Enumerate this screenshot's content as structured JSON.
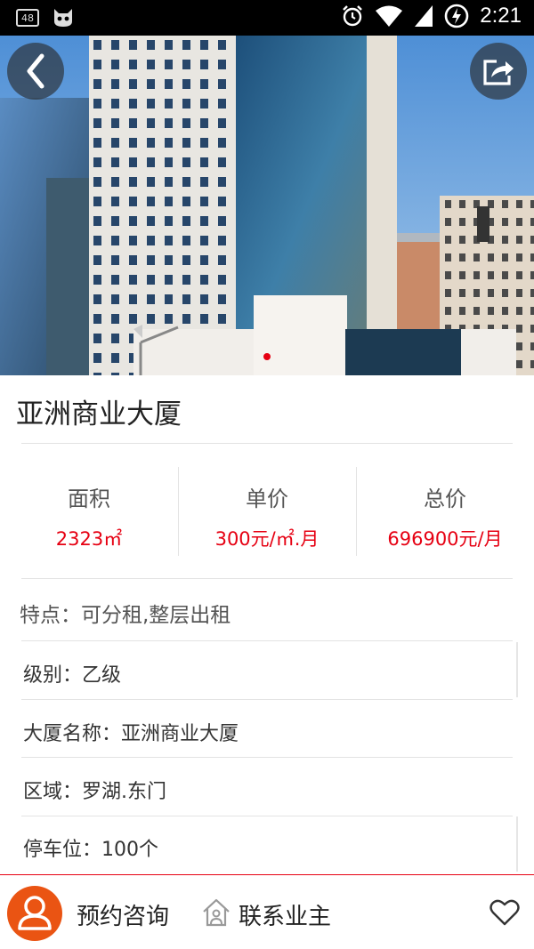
{
  "status_bar": {
    "notification_count": "48",
    "time": "2:21",
    "icons": [
      "cat-robot-icon",
      "alarm-icon",
      "wifi-icon",
      "signal-icon",
      "battery-charging-icon"
    ]
  },
  "hero": {
    "back_icon": "chevron-left-icon",
    "share_icon": "share-icon",
    "pager": {
      "count": 1,
      "active": 0,
      "active_color": "#e60012"
    }
  },
  "property": {
    "title": "亚洲商业大厦",
    "stats": [
      {
        "label": "面积",
        "value": "2323㎡"
      },
      {
        "label": "单价",
        "value": "300元/㎡.月"
      },
      {
        "label": "总价",
        "value": "696900元/月"
      }
    ],
    "feature": "特点：可分租,整层出租",
    "details": [
      "级别：乙级",
      "大厦名称：亚洲商业大厦",
      "区域：罗湖.东门",
      "停车位：100个"
    ]
  },
  "bottom_bar": {
    "consult_label": "预约咨询",
    "contact_label": "联系业主",
    "avatar_icon": "person-avatar-icon",
    "contact_icon": "house-person-icon",
    "favorite_icon": "heart-icon"
  },
  "colors": {
    "accent": "#e60012",
    "avatar_bg": "#ea5413",
    "status_bar": "#000000"
  }
}
